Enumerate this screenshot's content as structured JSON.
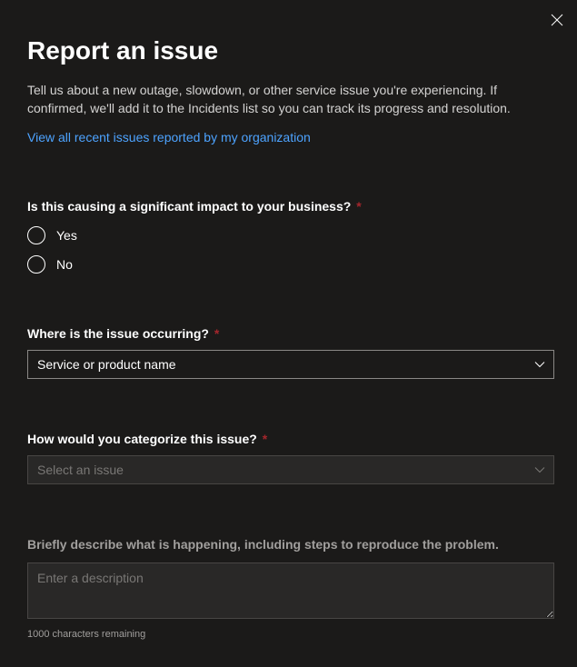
{
  "header": {
    "title": "Report an issue",
    "description": "Tell us about a new outage, slowdown, or other service issue you're experiencing. If confirmed, we'll add it to the Incidents list so you can track its progress and resolution.",
    "link": "View all recent issues reported by my organization"
  },
  "form": {
    "impact": {
      "label": "Is this causing a significant impact to your business?",
      "required": "*",
      "options": {
        "yes": "Yes",
        "no": "No"
      }
    },
    "location": {
      "label": "Where is the issue occurring?",
      "required": "*",
      "placeholder": "Service or product name"
    },
    "category": {
      "label": "How would you categorize this issue?",
      "required": "*",
      "placeholder": "Select an issue"
    },
    "description": {
      "label": "Briefly describe what is happening, including steps to reproduce the problem.",
      "placeholder": "Enter a description",
      "charCount": "1000 characters remaining"
    }
  }
}
